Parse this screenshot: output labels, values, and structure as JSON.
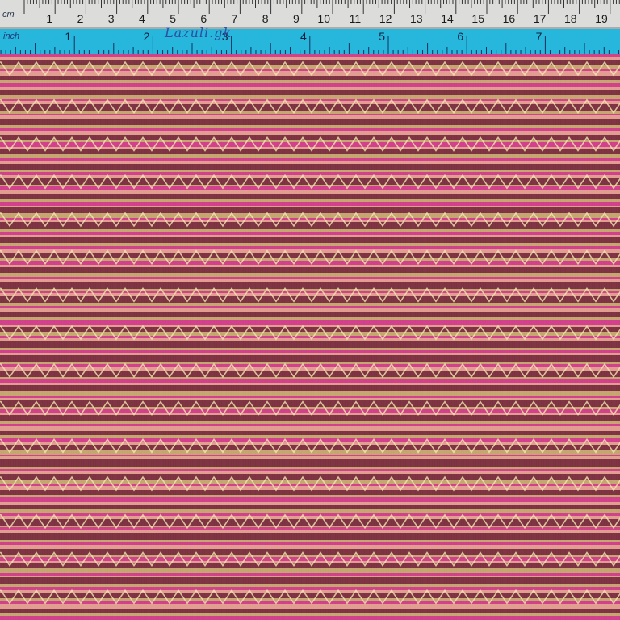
{
  "rulers": {
    "cm": {
      "unit_label": "cm",
      "numbers": [
        "1",
        "2",
        "3",
        "4",
        "5",
        "6",
        "7",
        "8",
        "9",
        "10",
        "11",
        "12",
        "13",
        "14",
        "15",
        "16",
        "17",
        "18",
        "19",
        "2"
      ]
    },
    "inch": {
      "unit_label": "inch",
      "numbers": [
        "1",
        "2",
        "3",
        "4",
        "5",
        "6",
        "7"
      ],
      "handwritten_note": "Lazuli.gk"
    }
  },
  "fabric": {
    "description_colors": {
      "magenta": "#d63a8e",
      "pink": "#e86aa8",
      "maroon": "#7a2b3e",
      "purple": "#6a3f7e",
      "blue": "#4f7fb5",
      "olive": "#9a9856",
      "tan": "#c8a870",
      "cream": "#f3e6b0",
      "salmon": "#e6a092"
    }
  }
}
